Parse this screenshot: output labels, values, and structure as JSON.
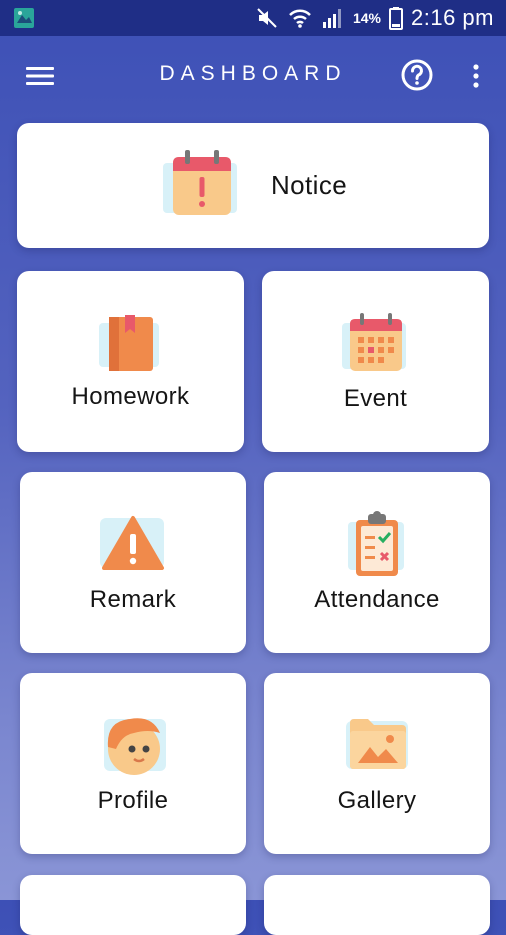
{
  "status_bar": {
    "battery_percent": "14%",
    "time": "2:16 pm"
  },
  "app_bar": {
    "title": "DASHBOARD"
  },
  "tiles": [
    {
      "label": "Notice",
      "icon": "calendar-alert-icon"
    },
    {
      "label": "Homework",
      "icon": "book-icon"
    },
    {
      "label": "Event",
      "icon": "calendar-icon"
    },
    {
      "label": "Remark",
      "icon": "warning-icon"
    },
    {
      "label": "Attendance",
      "icon": "clipboard-checklist-icon"
    },
    {
      "label": "Profile",
      "icon": "face-icon"
    },
    {
      "label": "Gallery",
      "icon": "photo-folder-icon"
    }
  ],
  "colors": {
    "status_bar": "#1f2e86",
    "app_bar_top": "#3d50b6",
    "accent_orange": "#f08a4b",
    "accent_red": "#e8596a"
  }
}
